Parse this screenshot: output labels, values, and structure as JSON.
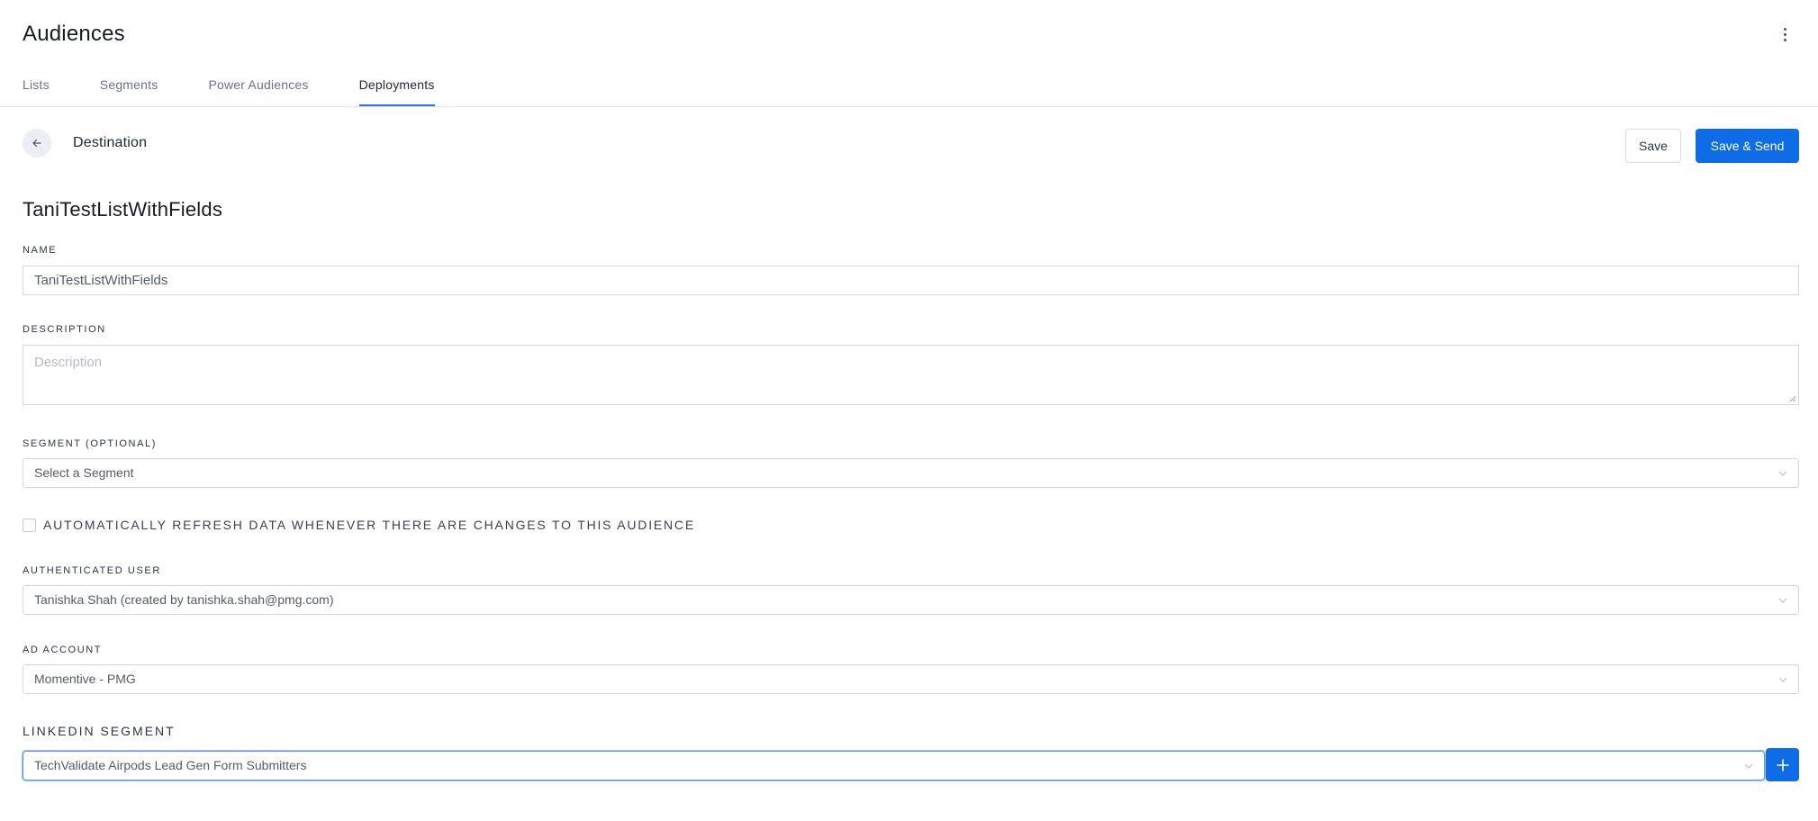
{
  "header": {
    "title": "Audiences",
    "more_icon": "kebab-vertical-icon"
  },
  "tabs": [
    {
      "label": "Lists",
      "active": false
    },
    {
      "label": "Segments",
      "active": false
    },
    {
      "label": "Power Audiences",
      "active": false
    },
    {
      "label": "Deployments",
      "active": true
    }
  ],
  "toolbar": {
    "back_icon": "arrow-left-icon",
    "title": "Destination",
    "save_label": "Save",
    "save_send_label": "Save & Send"
  },
  "form": {
    "list_title": "TaniTestListWithFields",
    "name": {
      "label": "Name",
      "value": "TaniTestListWithFields"
    },
    "description": {
      "label": "Description",
      "value": "",
      "placeholder": "Description"
    },
    "segment": {
      "label": "Segment (Optional)",
      "value": "Select a Segment"
    },
    "auto_refresh": {
      "label": "AUTOMATICALLY REFRESH DATA WHENEVER THERE ARE CHANGES TO THIS AUDIENCE",
      "checked": false
    },
    "authenticated_user": {
      "label": "Authenticated User",
      "value": "Tanishka Shah (created by tanishka.shah@pmg.com)"
    },
    "ad_account": {
      "label": "Ad Account",
      "value": "Momentive - PMG"
    },
    "linkedin_segment": {
      "label": "LinkedIn Segment",
      "value": "TechValidate Airpods Lead Gen Form Submitters",
      "add_icon": "plus-icon"
    }
  },
  "colors": {
    "accent": "#0e6de6",
    "tab_underline": "#2b73d6"
  }
}
